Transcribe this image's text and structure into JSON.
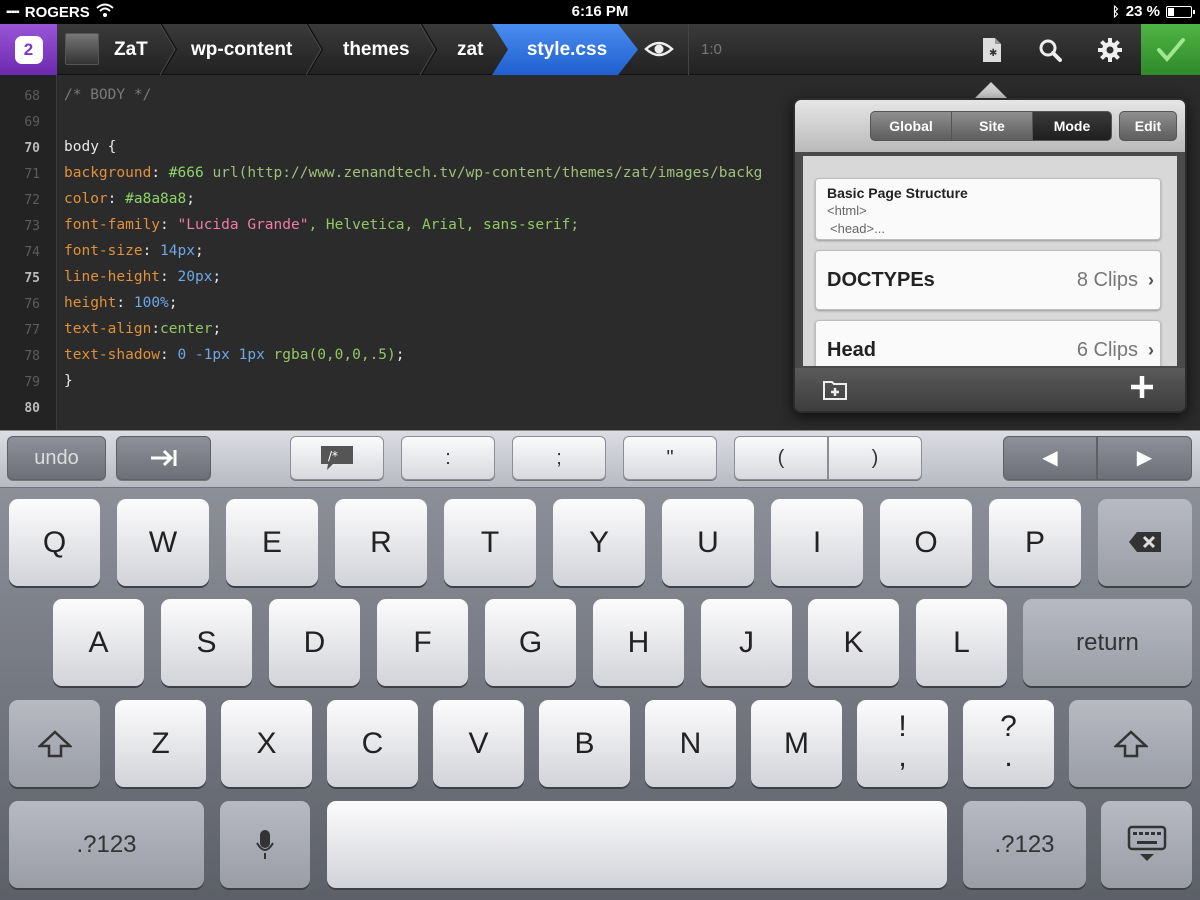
{
  "status_bar": {
    "carrier": "ROGERS",
    "time": "6:16 PM",
    "battery": "23 %",
    "battery_level": 0.23
  },
  "toolbar": {
    "app_badge": "2",
    "breadcrumbs": [
      "ZaT",
      "wp-content",
      "themes",
      "zat"
    ],
    "active_file": "style.css",
    "cursor_position": "1:0"
  },
  "editor": {
    "lines": [
      {
        "num": "68"
      },
      {
        "num": "69"
      },
      {
        "num": "70"
      },
      {
        "num": "71"
      },
      {
        "num": "72"
      },
      {
        "num": "73"
      },
      {
        "num": "74"
      },
      {
        "num": "75"
      },
      {
        "num": "76"
      },
      {
        "num": "77"
      },
      {
        "num": "78"
      },
      {
        "num": "79"
      },
      {
        "num": "80"
      }
    ],
    "code": {
      "l68": "/* BODY */",
      "l70": "body {",
      "l71_prop": "background",
      "l71_hex": "#666",
      "l71_url": "url(http://www.zenandtech.tv/wp-content/themes/zat/images/backg",
      "l72_prop": "color",
      "l72_hex": "#a8a8a8",
      "l73_prop": "font-family",
      "l73_str": "\"Lucida Grande\"",
      "l73_rest": ", Helvetica, Arial, sans-serif;",
      "l74_prop": "font-size",
      "l74_num": "14px",
      "l75_prop": "line-height",
      "l75_num": "20px",
      "l76_prop": "height",
      "l76_num": "100%",
      "l77_prop": "text-align",
      "l77_val": "center",
      "l78_prop": "text-shadow",
      "l78_num": "0 -1px 1px",
      "l78_val": "rgba(0,0,0,.5)",
      "l79": "}"
    }
  },
  "popover": {
    "tabs": [
      "Global",
      "Site",
      "Mode"
    ],
    "active_tab": "Mode",
    "edit_label": "Edit",
    "clips": [
      {
        "title": "Basic Page Structure",
        "line1": "<html>",
        "line2": "<head>..."
      },
      {
        "title": "DOCTYPEs",
        "count": "8 Clips"
      },
      {
        "title": "Head",
        "count": "6 Clips"
      }
    ]
  },
  "accessory_bar": {
    "undo": "undo",
    "keys": [
      ":",
      ";",
      "\"",
      "(",
      ")"
    ]
  },
  "keyboard": {
    "row1": [
      "Q",
      "W",
      "E",
      "R",
      "T",
      "Y",
      "U",
      "I",
      "O",
      "P"
    ],
    "row2": [
      "A",
      "S",
      "D",
      "F",
      "G",
      "H",
      "J",
      "K",
      "L"
    ],
    "return_label": "return",
    "row3": [
      "Z",
      "X",
      "C",
      "V",
      "B",
      "N",
      "M"
    ],
    "punct1": [
      "!",
      ","
    ],
    "punct2": [
      "?",
      "."
    ],
    "numbers_label": ".?123"
  },
  "colors": {
    "accent_purple": "#8a47cc",
    "active_blue": "#2a6fe0",
    "done_green": "#3f9f36"
  }
}
